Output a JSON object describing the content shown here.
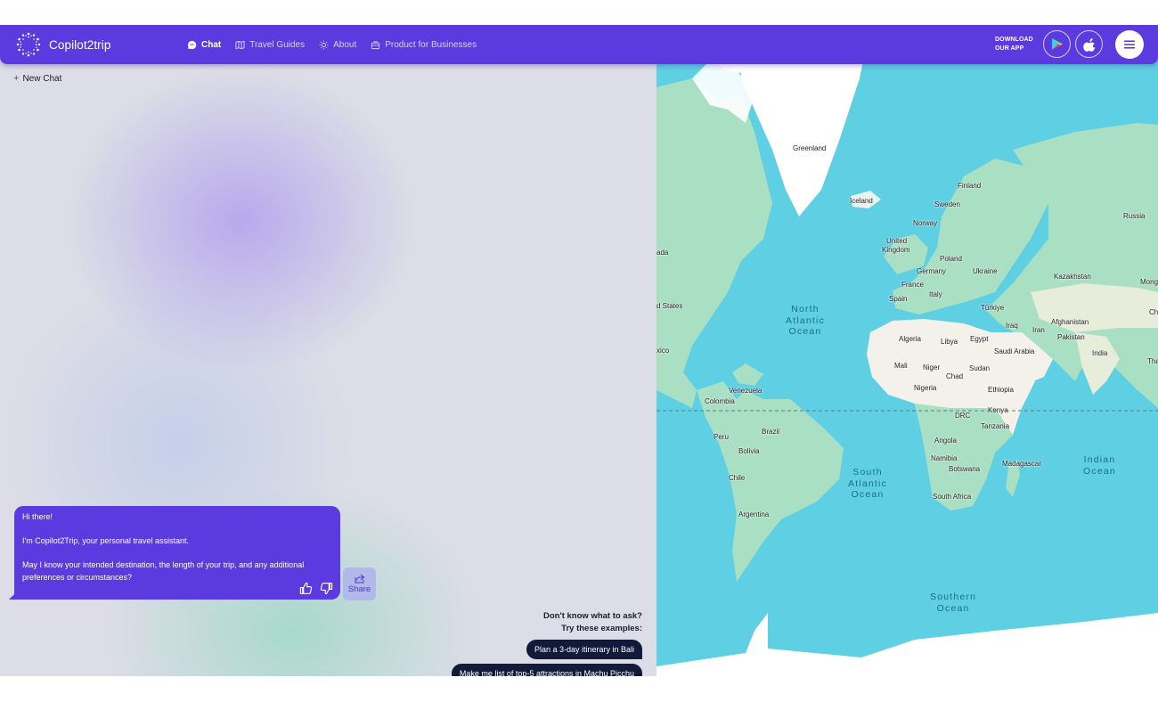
{
  "header": {
    "logo_text": "Copilot2trip",
    "nav": [
      {
        "label": "Chat",
        "icon": "chat-bubble-icon",
        "active": true
      },
      {
        "label": "Travel Guides",
        "icon": "map-book-icon",
        "active": false
      },
      {
        "label": "About",
        "icon": "sun-icon",
        "active": false
      },
      {
        "label": "Product for Businesses",
        "icon": "briefcase-icon",
        "active": false
      }
    ],
    "download_line1": "DOWNLOAD",
    "download_line2": "OUR APP",
    "store_buttons": [
      "google-play-icon",
      "apple-icon"
    ],
    "menu_icon": "hamburger-icon"
  },
  "chat": {
    "new_chat_label": "New Chat",
    "bot_message": {
      "line1": "Hi there!",
      "line2": "I'm Copilot2Trip, your personal travel assistant.",
      "line3": "May I know your intended destination, the length of your trip, and any additional preferences or circumstances?"
    },
    "share_label": "Share",
    "examples_title_line1": "Don't know what to ask?",
    "examples_title_line2": "Try these examples:",
    "examples": [
      "Plan a 3-day itinerary in Bali",
      "Make me list of top-5 attractions in Machu Picchu"
    ]
  },
  "map": {
    "colors": {
      "water": "#5fcfe3",
      "land": "#a9dfc2",
      "desert": "#f3f1ea",
      "ice": "#ffffff"
    },
    "oceans": [
      {
        "id": "north-atlantic",
        "line1": "North",
        "line2": "Atlantic",
        "line3": "Ocean"
      },
      {
        "id": "south-atlantic",
        "line1": "South",
        "line2": "Atlantic",
        "line3": "Ocean"
      },
      {
        "id": "indian",
        "line1": "Indian",
        "line2": "Ocean"
      },
      {
        "id": "southern",
        "line1": "Southern",
        "line2": "Ocean"
      }
    ],
    "countries": [
      "Greenland",
      "Iceland",
      "Finland",
      "Sweden",
      "Norway",
      "Russia",
      "United",
      "Kingdom",
      "Poland",
      "Germany",
      "Ukraine",
      "France",
      "Kazakhstan",
      "Mong",
      "Italy",
      "Spain",
      "Türkiye",
      "Chi",
      "ada",
      "d States",
      "Afghanistan",
      "Iraq",
      "Iran",
      "Pakistan",
      "Algeria",
      "Libya",
      "Egypt",
      "xico",
      "Saudi Arabia",
      "India",
      "Thaila",
      "Mali",
      "Niger",
      "Sudan",
      "Chad",
      "Venezuela",
      "Nigeria",
      "Ethiopia",
      "Colombia",
      "Kenya",
      "DRC",
      "Tanzania",
      "Peru",
      "Brazil",
      "Angola",
      "Bolivia",
      "Namibia",
      "Madagascar",
      "Botswana",
      "Chile",
      "South Africa",
      "Argentina"
    ]
  }
}
